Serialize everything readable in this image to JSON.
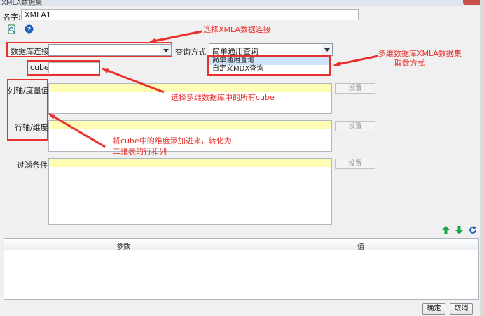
{
  "window": {
    "title": "XMLA数据集"
  },
  "name_field": {
    "label": "名字:",
    "value": "XMLA1"
  },
  "icons": {
    "preview": "preview-icon",
    "help": "help-icon",
    "move_up": "arrow-up-icon",
    "move_down": "arrow-down-icon",
    "refresh": "refresh-icon"
  },
  "connection": {
    "label": "数据库连接:",
    "value": ""
  },
  "query_mode": {
    "label": "查询方式",
    "value": "简单通用查询",
    "options": [
      "简单通用查询",
      "自定义MDX查询"
    ]
  },
  "cube": {
    "label": "cube:",
    "value": ""
  },
  "columns_axis": {
    "label": "列轴/度量值:",
    "button": "设置"
  },
  "rows_axis": {
    "label": "行轴/维度:",
    "button": "设置"
  },
  "filter": {
    "label": "过滤条件:",
    "button": "设置"
  },
  "params_table": {
    "headers": [
      "参数",
      "值"
    ]
  },
  "footer": {
    "ok": "确定",
    "cancel": "取消"
  },
  "annotations": {
    "select_connection": "选择XMLA数据连接",
    "query_mode_note_line1": "多维数据库XMLA数据集",
    "query_mode_note_line2": "取数方式",
    "select_cube": "选择多维数据库中的所有cube",
    "dimensions_line1": "将cube中的维度添加进来，转化为",
    "dimensions_line2": "二维表的行和列"
  },
  "colors": {
    "annotation_red": "#e8302c",
    "highlight_yellow": "#fffdb3",
    "green_arrow": "#1aa64a",
    "help_blue": "#1f5fbf"
  }
}
